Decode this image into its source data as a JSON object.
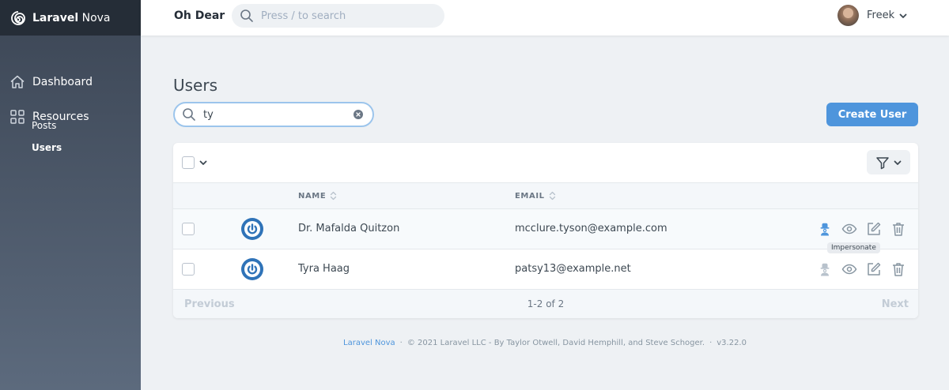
{
  "sidebar": {
    "brand_bold": "Laravel",
    "brand_light": " Nova",
    "items": [
      {
        "label": "Dashboard",
        "icon": "home-icon"
      },
      {
        "label": "Resources",
        "icon": "grid-icon"
      }
    ],
    "sub_items": [
      {
        "label": "Posts",
        "active": false
      },
      {
        "label": "Users",
        "active": true
      }
    ]
  },
  "header": {
    "app_name": "Oh Dear",
    "search_placeholder": "Press / to search",
    "user_name": "Freek"
  },
  "main": {
    "title": "Users",
    "search_value": "ty",
    "create_label": "Create User",
    "columns": [
      "NAME",
      "EMAIL"
    ],
    "rows": [
      {
        "name": "Dr. Mafalda Quitzon",
        "email": "mcclure.tyson@example.com"
      },
      {
        "name": "Tyra Haag",
        "email": "patsy13@example.net"
      }
    ],
    "pagination": {
      "previous": "Previous",
      "info": "1-2 of 2",
      "next": "Next"
    },
    "tooltip": "Impersonate"
  },
  "footer": {
    "link": "Laravel Nova",
    "copyright": "© 2021 Laravel LLC - By Taylor Otwell, David Hemphill, and Steve Schoger.",
    "version": "v3.22.0"
  },
  "colors": {
    "accent": "#4e95dc",
    "sidebar_top": "#3c4655",
    "sidebar_bottom": "#5c6a7d",
    "brand_bar": "#252d37"
  }
}
